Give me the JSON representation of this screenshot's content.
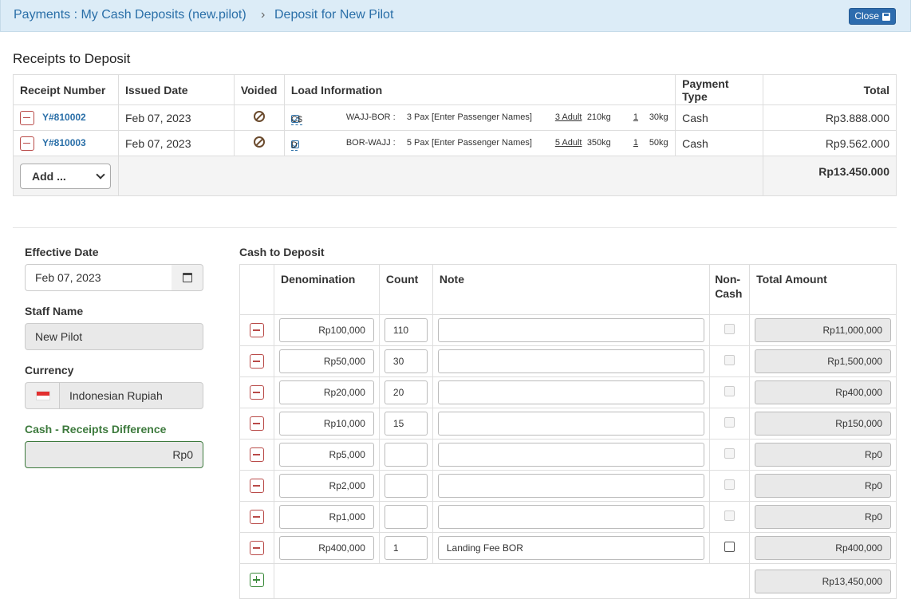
{
  "header": {
    "crumb1": "Payments : My Cash Deposits (new.pilot)",
    "sep": "›",
    "crumb2": "Deposit for New Pilot",
    "close_label": "Close"
  },
  "receipts": {
    "title": "Receipts to Deposit",
    "columns": [
      "Receipt Number",
      "Issued Date",
      "Voided",
      "Load Information",
      "Payment Type",
      "Total"
    ],
    "rows": [
      {
        "number": "Y#810002",
        "date": "Feb 07, 2023",
        "load_code": "C$",
        "route": "WAJJ-BOR :",
        "pax": "3 Pax [Enter Passenger Names]",
        "adult": "3 Adult",
        "weight": "210kg",
        "bags": "1",
        "bag_weight": "30kg",
        "payment": "Cash",
        "total": "Rp3.888.000"
      },
      {
        "number": "Y#810003",
        "date": "Feb 07, 2023",
        "load_code": "D",
        "route": "BOR-WAJJ :",
        "pax": "5 Pax [Enter Passenger Names]",
        "adult": "5 Adult",
        "weight": "350kg",
        "bags": "1",
        "bag_weight": "50kg",
        "payment": "Cash",
        "total": "Rp9.562.000"
      }
    ],
    "add_label": "Add ...",
    "grand_total": "Rp13.450.000"
  },
  "form": {
    "effective_date_label": "Effective Date",
    "effective_date": "Feb 07, 2023",
    "staff_label": "Staff Name",
    "staff": "New Pilot",
    "currency_label": "Currency",
    "currency": "Indonesian Rupiah",
    "diff_label": "Cash - Receipts Difference",
    "diff_value": "Rp0"
  },
  "cash": {
    "title": "Cash to Deposit",
    "columns": {
      "denomination": "Denomination",
      "count": "Count",
      "note": "Note",
      "noncash1": "Non-",
      "noncash2": "Cash",
      "total": "Total Amount"
    },
    "rows": [
      {
        "denom": "Rp100,000",
        "count": "110",
        "note": "",
        "total": "Rp11,000,000",
        "noncash_enabled": false
      },
      {
        "denom": "Rp50,000",
        "count": "30",
        "note": "",
        "total": "Rp1,500,000",
        "noncash_enabled": false
      },
      {
        "denom": "Rp20,000",
        "count": "20",
        "note": "",
        "total": "Rp400,000",
        "noncash_enabled": false
      },
      {
        "denom": "Rp10,000",
        "count": "15",
        "note": "",
        "total": "Rp150,000",
        "noncash_enabled": false
      },
      {
        "denom": "Rp5,000",
        "count": "",
        "note": "",
        "total": "Rp0",
        "noncash_enabled": false
      },
      {
        "denom": "Rp2,000",
        "count": "",
        "note": "",
        "total": "Rp0",
        "noncash_enabled": false
      },
      {
        "denom": "Rp1,000",
        "count": "",
        "note": "",
        "total": "Rp0",
        "noncash_enabled": false
      },
      {
        "denom": "Rp400,000",
        "count": "1",
        "note": "Landing Fee BOR",
        "total": "Rp400,000",
        "noncash_enabled": true
      }
    ],
    "grand_total": "Rp13,450,000"
  }
}
